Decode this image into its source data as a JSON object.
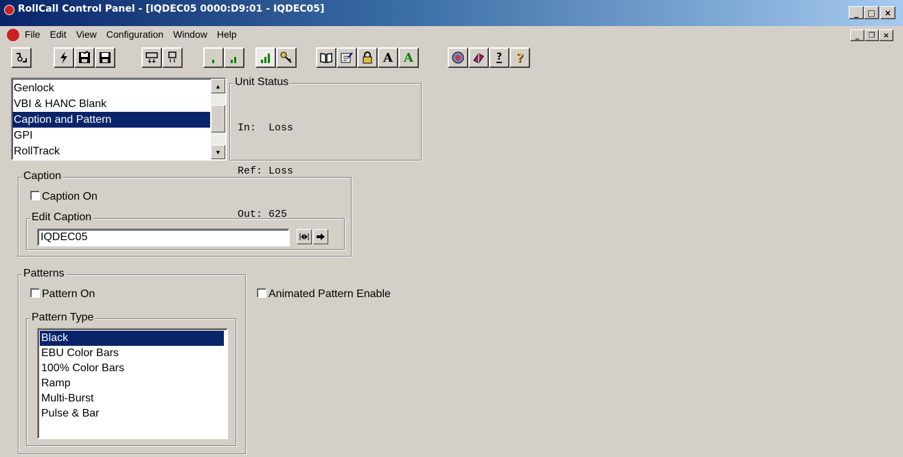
{
  "window": {
    "title": "RollCall Control Panel - [IQDEC05 0000:D9:01 - IQDEC05]",
    "minimize": "_",
    "maximize": "□",
    "close": "×"
  },
  "menu": {
    "items": [
      "File",
      "Edit",
      "View",
      "Configuration",
      "Window",
      "Help"
    ],
    "mdi_minimize": "_",
    "mdi_restore": "❐",
    "mdi_close": "×"
  },
  "toolbar": {
    "icons": [
      "connect-icon",
      "lightning-icon",
      "save-icon",
      "save-all-icon",
      "download-icon",
      "upload-icon",
      "signal-low-icon",
      "signal-medium-icon",
      "signal-high-icon",
      "key-icon",
      "book-icon",
      "edit-icon",
      "lock-icon",
      "font-a-icon",
      "font-a-green-icon",
      "network-icon",
      "help-book-icon",
      "help-icon",
      "question-icon"
    ],
    "font_a": "A",
    "font_a_green": "A",
    "question": "?",
    "help_label": "?"
  },
  "nav_list": {
    "items": [
      "Genlock",
      "VBI & HANC Blank",
      "Caption and Pattern",
      "GPI",
      "RollTrack"
    ],
    "selected": "Caption and Pattern"
  },
  "unit_status": {
    "label": "Unit Status",
    "lines": [
      "In:  Loss",
      "Ref: Loss",
      "Out: 625"
    ]
  },
  "caption": {
    "label": "Caption",
    "caption_on": "Caption On",
    "edit_caption_label": "Edit Caption",
    "value": "IQDEC05"
  },
  "patterns": {
    "label": "Patterns",
    "pattern_on": "Pattern On",
    "animated": "Animated Pattern Enable",
    "type_label": "Pattern Type",
    "types": [
      "Black",
      "EBU Color Bars",
      "100% Color Bars",
      "Ramp",
      "Multi-Burst",
      "Pulse & Bar"
    ],
    "selected": "Black"
  },
  "colors": {
    "face": "#d4d0c8",
    "selection": "#0a246a",
    "title_start": "#0a246a",
    "title_end": "#a6caf0"
  }
}
